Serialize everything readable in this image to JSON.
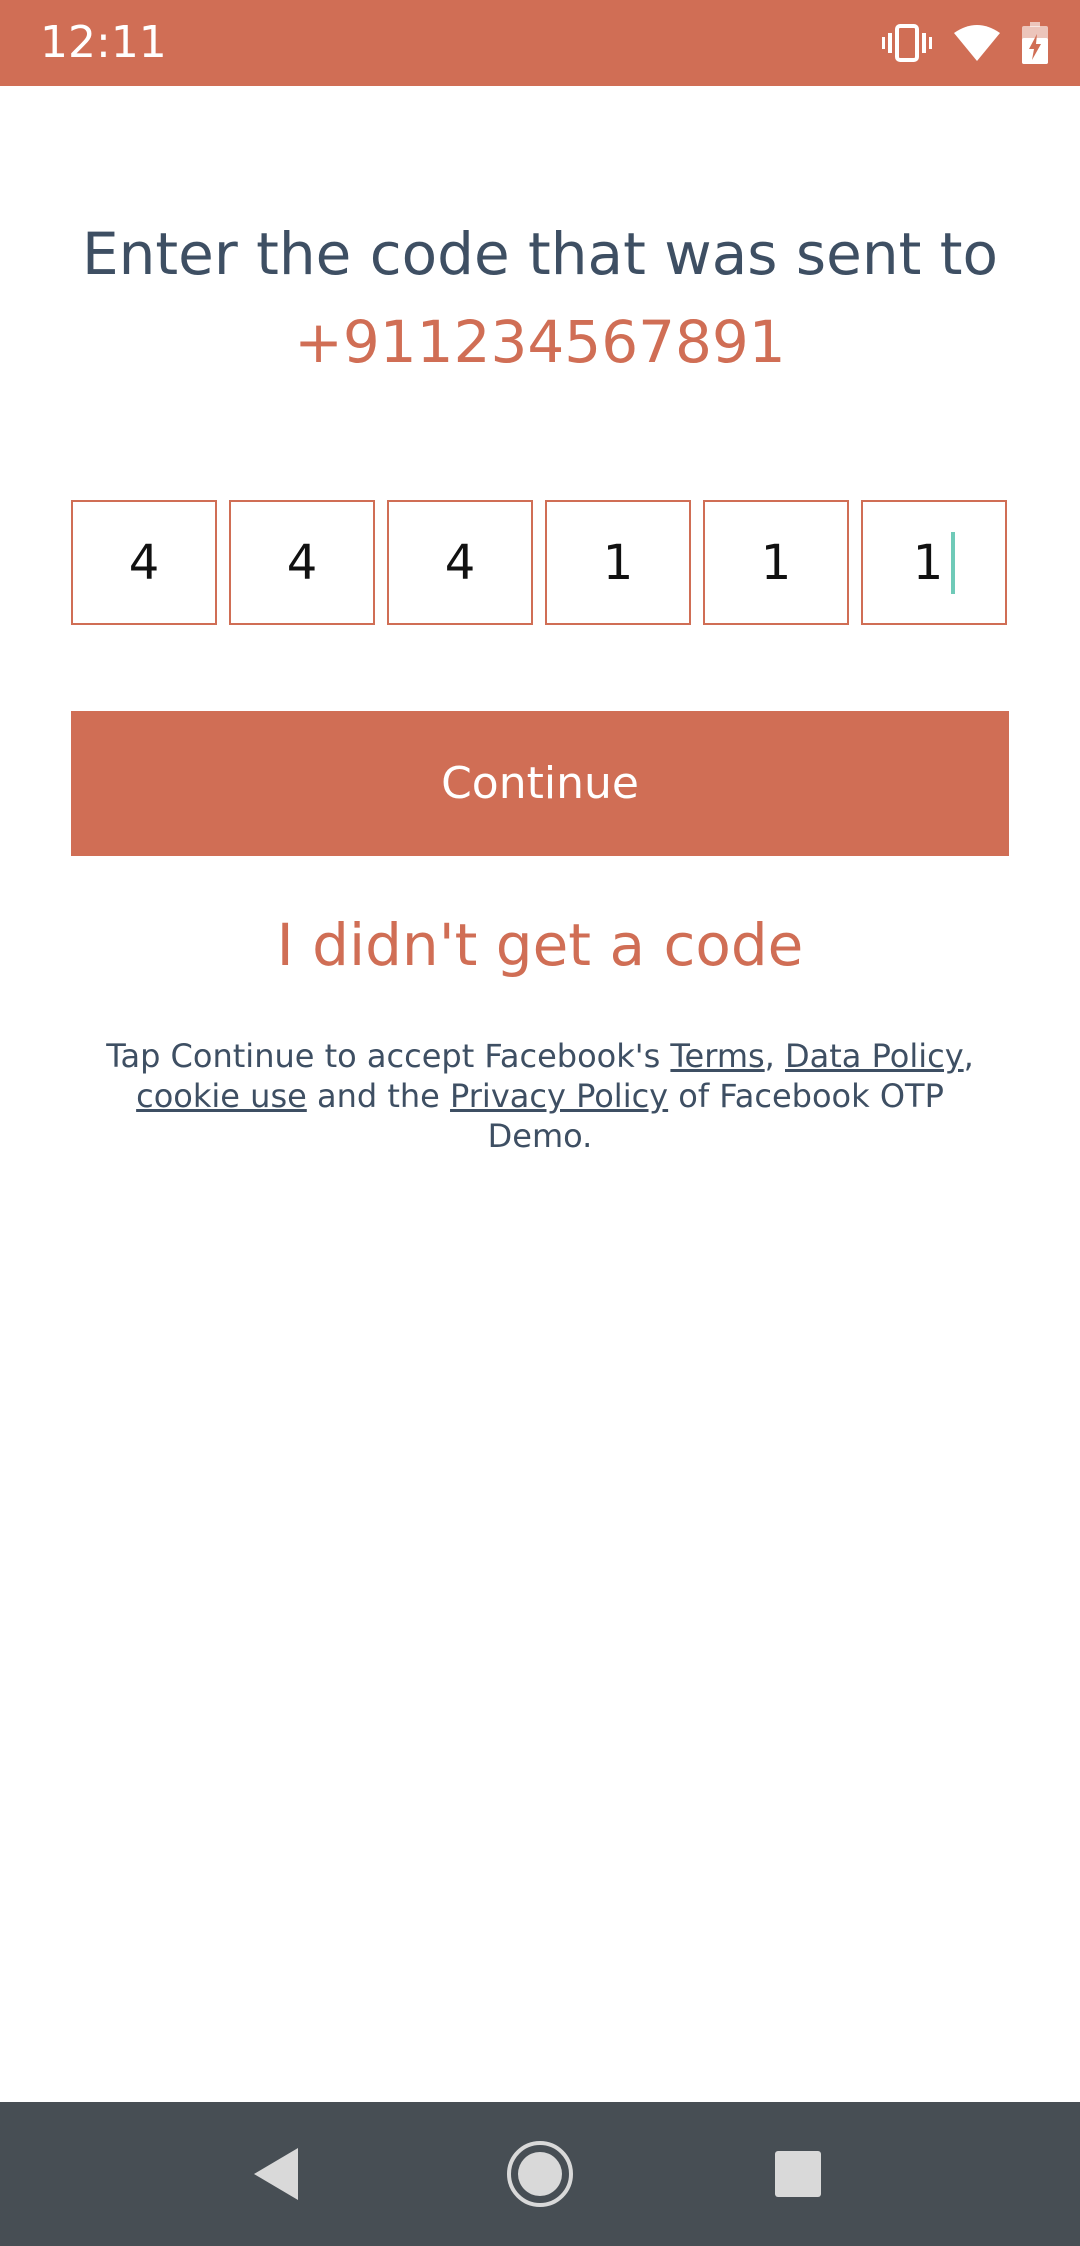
{
  "status_bar": {
    "time": "12:11",
    "icons": [
      "vibrate-icon",
      "wifi-icon",
      "battery-charging-icon"
    ]
  },
  "otp": {
    "heading": "Enter the code that was sent to",
    "phone_number": "+911234567891",
    "digits": [
      "4",
      "4",
      "4",
      "1",
      "1",
      "1"
    ],
    "continue_label": "Continue",
    "no_code_label": "I didn't get a code"
  },
  "terms": {
    "prefix": "Tap Continue to accept Facebook's ",
    "terms_link": "Terms",
    "sep1": ", ",
    "data_policy_link": "Data Policy",
    "sep2": ", ",
    "cookie_link": "cookie use",
    "middle": " and the ",
    "privacy_link": "Privacy Policy",
    "suffix": " of Facebook OTP Demo."
  },
  "colors": {
    "accent": "#d06e55",
    "text_dark": "#3e4f63",
    "nav_bar": "#474e54",
    "cursor": "#6fcab8"
  }
}
